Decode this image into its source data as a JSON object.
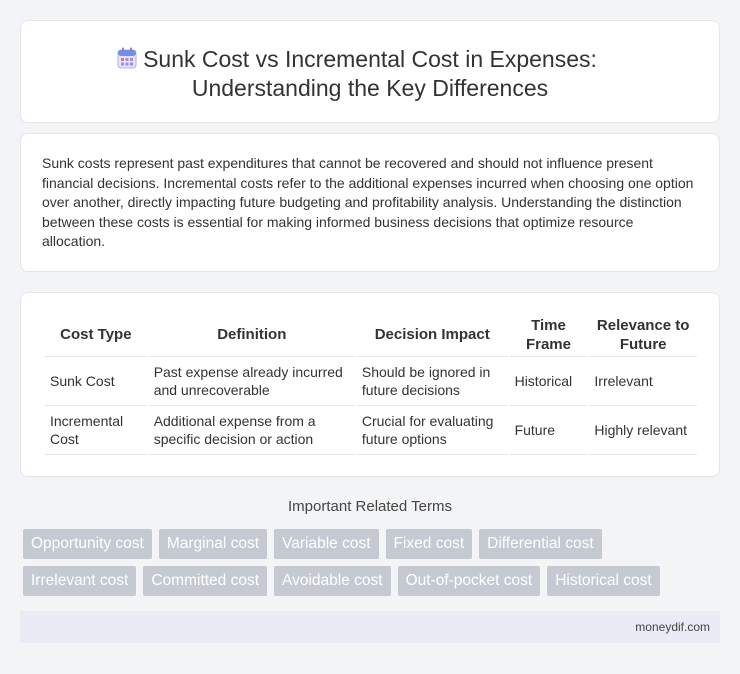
{
  "header": {
    "title_line1": "Sunk Cost vs Incremental Cost in Expenses:",
    "title_line2": "Understanding the Key Differences",
    "icon": "calendar-icon"
  },
  "intro": {
    "text": "Sunk costs represent past expenditures that cannot be recovered and should not influence present financial decisions. Incremental costs refer to the additional expenses incurred when choosing one option over another, directly impacting future budgeting and profitability analysis. Understanding the distinction between these costs is essential for making informed business decisions that optimize resource allocation."
  },
  "table": {
    "headers": [
      "Cost Type",
      "Definition",
      "Decision Impact",
      "Time Frame",
      "Relevance to Future"
    ],
    "rows": [
      [
        "Sunk Cost",
        "Past expense already incurred and unrecoverable",
        "Should be ignored in future decisions",
        "Historical",
        "Irrelevant"
      ],
      [
        "Incremental Cost",
        "Additional expense from a specific decision or action",
        "Crucial for evaluating future options",
        "Future",
        "Highly relevant"
      ]
    ]
  },
  "related": {
    "title": "Important Related Terms",
    "tags": [
      "Opportunity cost",
      "Marginal cost",
      "Variable cost",
      "Fixed cost",
      "Differential cost",
      "Irrelevant cost",
      "Committed cost",
      "Avoidable cost",
      "Out-of-pocket cost",
      "Historical cost"
    ]
  },
  "footer": {
    "site": "moneydif.com"
  },
  "colors": {
    "background": "#f3f4f6",
    "tag_bg": "#c4c9d2",
    "footer_bg": "#e9ecf5"
  }
}
